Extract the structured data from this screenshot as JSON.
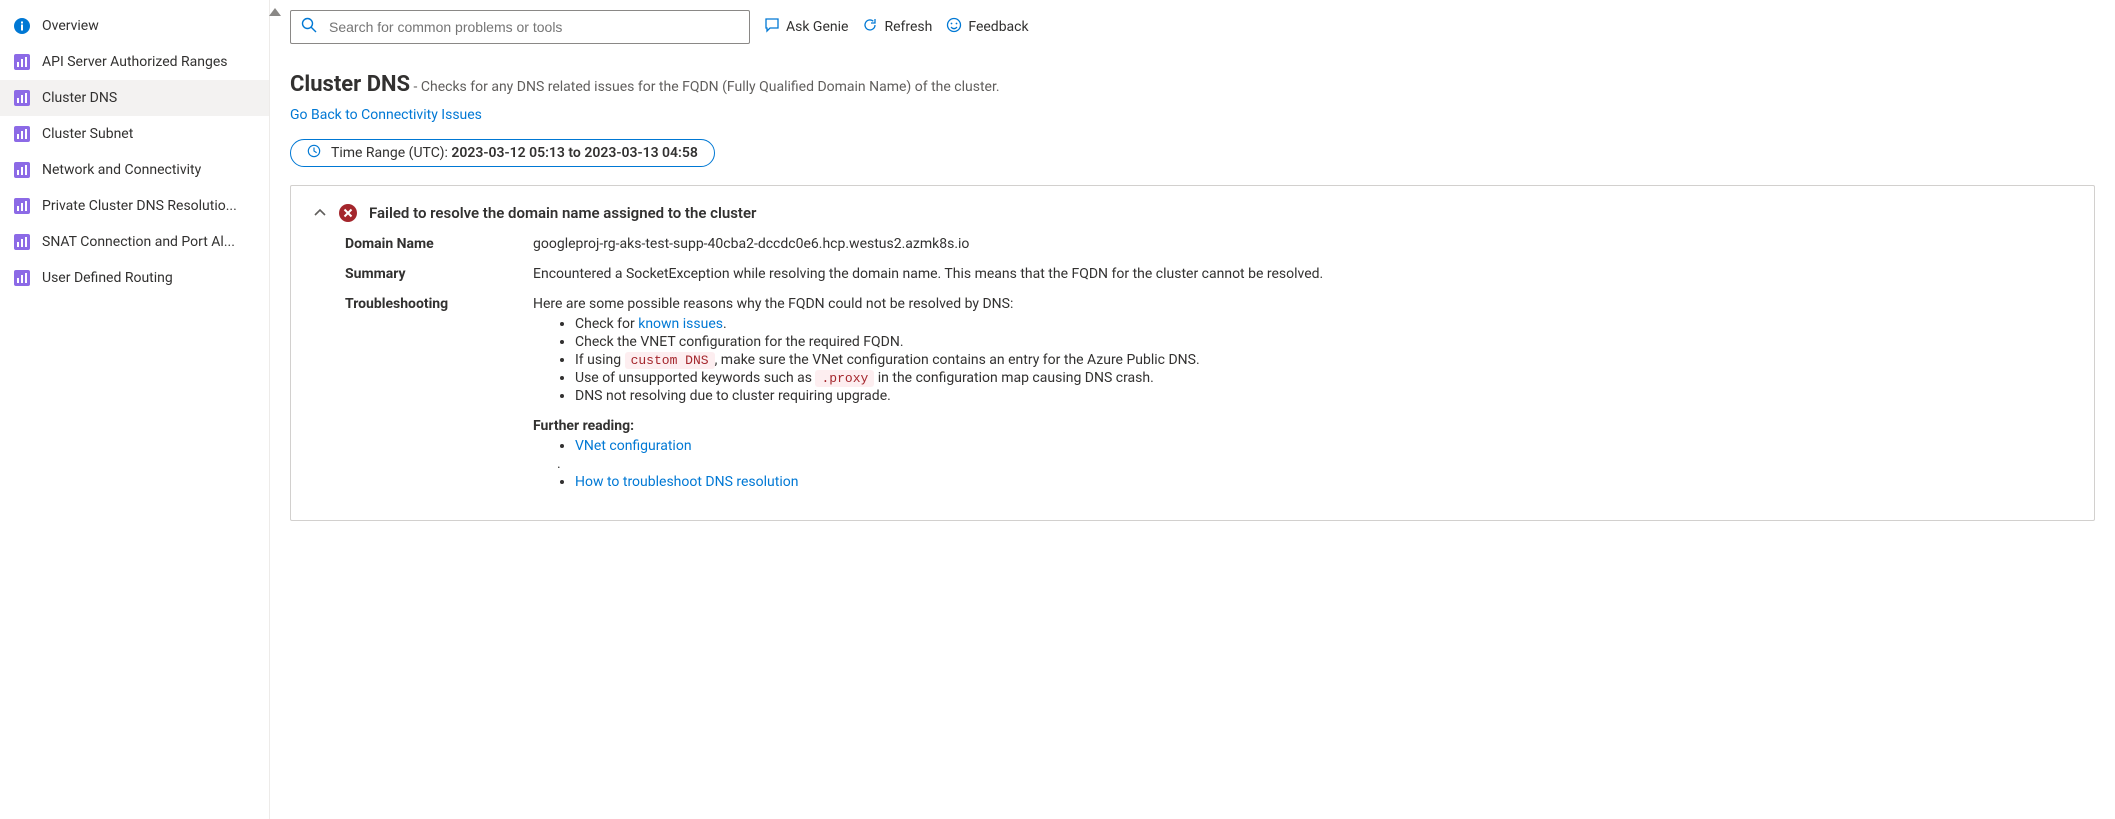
{
  "sidebar": {
    "overview_label": "Overview",
    "items": [
      {
        "label": "API Server Authorized Ranges"
      },
      {
        "label": "Cluster DNS"
      },
      {
        "label": "Cluster Subnet"
      },
      {
        "label": "Network and Connectivity"
      },
      {
        "label": "Private Cluster DNS Resolutio..."
      },
      {
        "label": "SNAT Connection and Port Al..."
      },
      {
        "label": "User Defined Routing"
      }
    ]
  },
  "toolbar": {
    "search_placeholder": "Search for common problems or tools",
    "ask_genie": "Ask Genie",
    "refresh": "Refresh",
    "feedback": "Feedback"
  },
  "header": {
    "title": "Cluster DNS",
    "subtitle": " -  Checks for any DNS related issues for the FQDN (Fully Qualified Domain Name) of the cluster.",
    "back": "Go Back to Connectivity Issues",
    "time_label": "Time Range (UTC): ",
    "time_value": "2023-03-12 05:13 to 2023-03-13 04:58"
  },
  "diag": {
    "title": "Failed to resolve the domain name assigned to the cluster",
    "domain_label": "Domain Name",
    "domain_value": "googleproj-rg-aks-test-supp-40cba2-dccdc0e6.hcp.westus2.azmk8s.io",
    "summary_label": "Summary",
    "summary_value": "Encountered a SocketException while resolving the domain name. This means that the FQDN for the cluster cannot be resolved.",
    "ts_label": "Troubleshooting",
    "ts_intro": "Here are some possible reasons why the FQDN could not be resolved by DNS:",
    "ts_items": {
      "i0_pre": "Check for ",
      "i0_link": "known issues",
      "i0_post": ".",
      "i1": "Check the VNET configuration for the required FQDN.",
      "i2_pre": "If using ",
      "i2_code": "custom DNS",
      "i2_post": ", make sure the VNet configuration contains an entry for the Azure Public DNS.",
      "i3_pre": "Use of unsupported keywords such as ",
      "i3_code": ".proxy",
      "i3_post": " in the configuration map causing DNS crash.",
      "i4": "DNS not resolving due to cluster requiring upgrade."
    },
    "fr_label": "Further reading:",
    "fr_links": {
      "l0": "VNet configuration",
      "dot": ".",
      "l1": "How to troubleshoot DNS resolution"
    }
  }
}
